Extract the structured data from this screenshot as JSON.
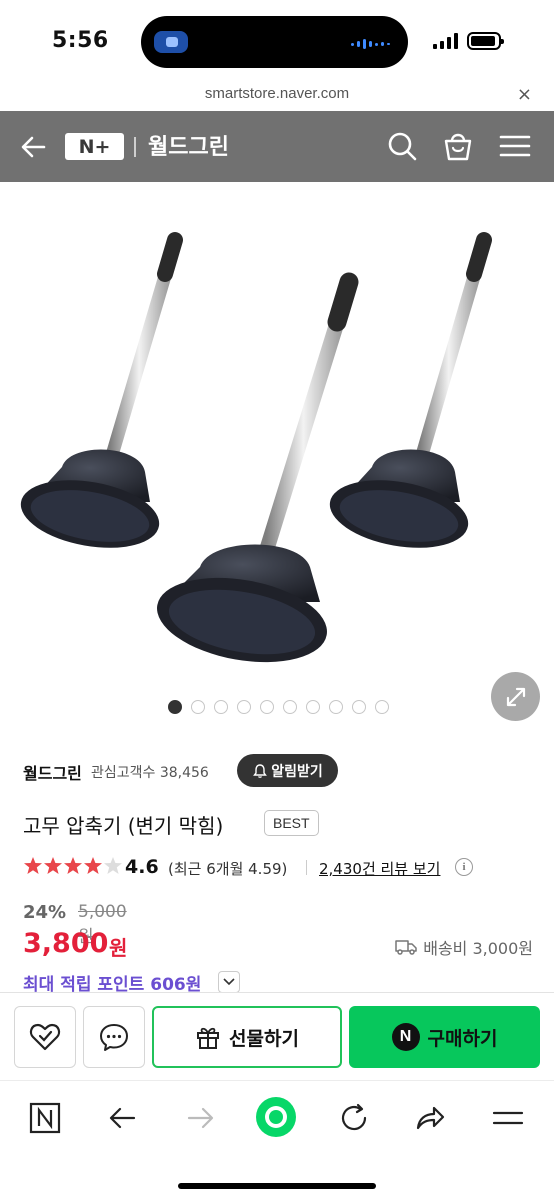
{
  "status_bar": {
    "time": "5:56"
  },
  "browser": {
    "url": "smartstore.naver.com",
    "close_label": "×"
  },
  "header": {
    "logo": "N+",
    "store_name": "월드그린",
    "icons": [
      "back-arrow-icon",
      "search-icon",
      "shopping-bag-icon",
      "menu-icon"
    ],
    "background": "#717171"
  },
  "gallery": {
    "image_count": 10,
    "active_index": 0
  },
  "store": {
    "name": "월드그린",
    "followers_label": "관심고객수 38,456",
    "alarm_label": "알림받기"
  },
  "product": {
    "title": "고무 압축기 (변기 막힘)",
    "badge": "BEST",
    "rating": "4.6",
    "rating_value": 4.6,
    "recent_rating": "(최근 6개월 4.59)",
    "reviews_label": "2,430건 리뷰 보기",
    "discount": "24%",
    "original_price": "5,000원",
    "price": "3,800",
    "price_unit": "원",
    "shipping": "배송비 3,000원",
    "points": "최대 적립 포인트 606원"
  },
  "actions": {
    "gift_label": "선물하기",
    "buy_label": "구매하기",
    "buy_badge": "N",
    "buy_color": "#07c75c",
    "price_color": "#e3203a",
    "points_color": "#6b4fd1"
  },
  "toolbar": {
    "icons": [
      "naver-n-icon",
      "back-icon",
      "forward-icon",
      "green-home-icon",
      "reload-icon",
      "share-icon",
      "menu-icon"
    ]
  }
}
